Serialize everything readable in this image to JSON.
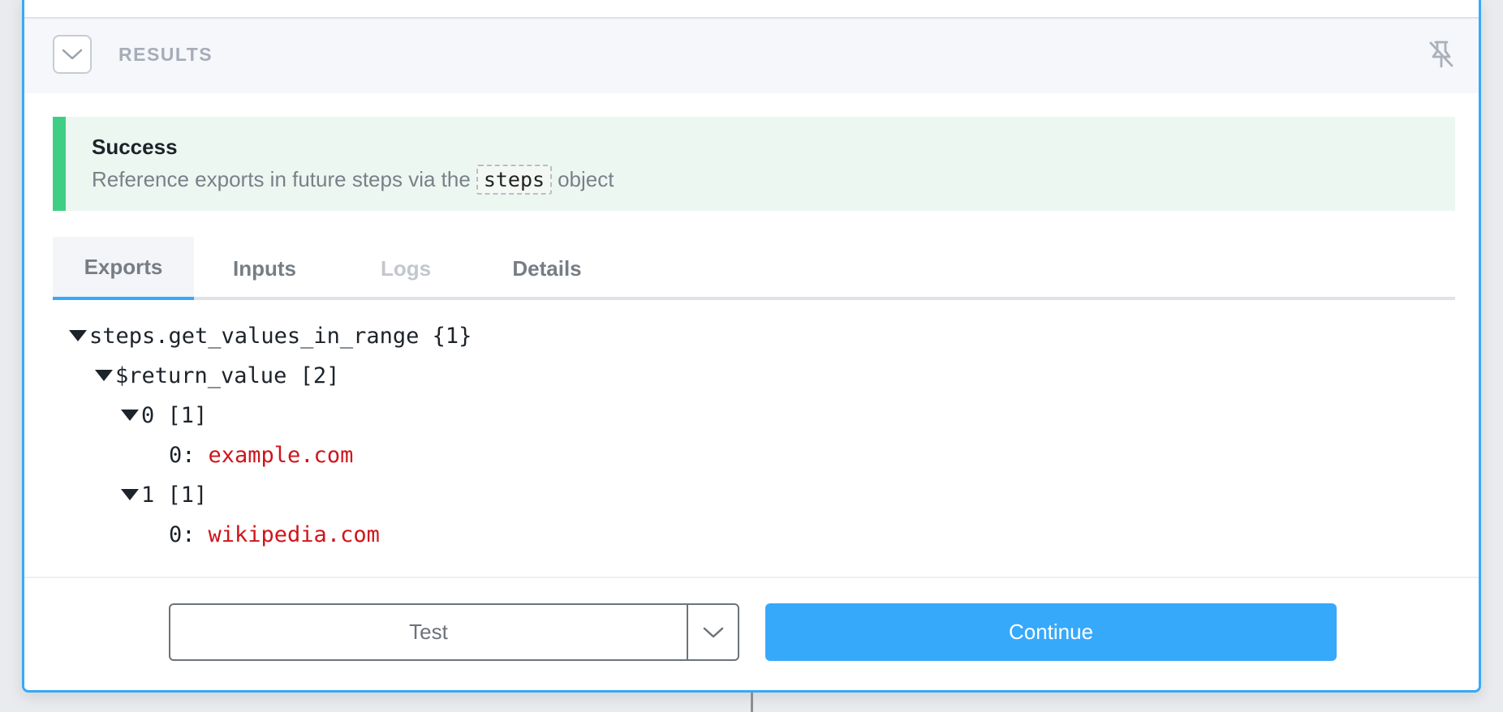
{
  "results": {
    "title": "RESULTS",
    "collapse_icon": "chevron-down-icon",
    "pin_icon": "unpin-icon"
  },
  "success": {
    "title": "Success",
    "message_before": "Reference exports in future steps via the",
    "code": "steps",
    "message_after": "object",
    "accent_color": "#3ecf85"
  },
  "tabs": [
    {
      "label": "Exports",
      "active": true
    },
    {
      "label": "Inputs",
      "active": false
    },
    {
      "label": "Logs",
      "disabled": true
    },
    {
      "label": "Details",
      "active": false
    }
  ],
  "tree": {
    "root": "steps.get_values_in_range {1}",
    "return_value": "$return_value [2]",
    "item0": "0 [1]",
    "item0_key": "0:",
    "item0_value": "example.com",
    "item1": "1 [1]",
    "item1_key": "0:",
    "item1_value": "wikipedia.com"
  },
  "footer": {
    "test_label": "Test",
    "continue_label": "Continue",
    "primary_color": "#37a9fb"
  }
}
